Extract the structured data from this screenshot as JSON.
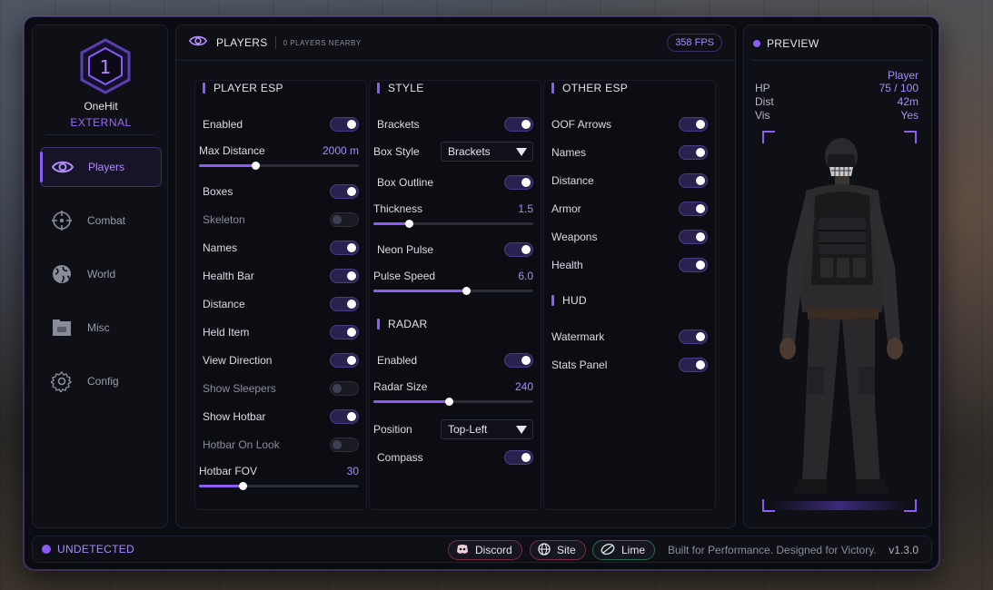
{
  "brand": {
    "logo_number": "1",
    "name": "OneHit",
    "sub": "EXTERNAL"
  },
  "nav": [
    {
      "label": "Players",
      "icon": "eye-icon",
      "active": true
    },
    {
      "label": "Combat",
      "icon": "crosshair-icon"
    },
    {
      "label": "World",
      "icon": "globe-icon"
    },
    {
      "label": "Misc",
      "icon": "box-icon"
    },
    {
      "label": "Config",
      "icon": "gear-icon"
    }
  ],
  "header": {
    "title": "PLAYERS",
    "subtitle": "0 PLAYERS NEARBY",
    "fps": "358 FPS"
  },
  "player_esp": {
    "title": "PLAYER ESP",
    "enabled": "Enabled",
    "max_distance": {
      "label": "Max Distance",
      "value": "2000 m",
      "fraction": 0.35
    },
    "toggles": [
      {
        "label": "Boxes",
        "on": true
      },
      {
        "label": "Skeleton",
        "on": false
      },
      {
        "label": "Names",
        "on": true
      },
      {
        "label": "Health Bar",
        "on": true
      },
      {
        "label": "Distance",
        "on": true
      },
      {
        "label": "Held Item",
        "on": true
      },
      {
        "label": "View Direction",
        "on": true
      },
      {
        "label": "Show Sleepers",
        "on": false
      },
      {
        "label": "Show Hotbar",
        "on": true
      },
      {
        "label": "Hotbar On Look",
        "on": false
      }
    ],
    "hotbar_fov": {
      "label": "Hotbar FOV",
      "value": "30",
      "fraction": 0.27
    }
  },
  "style": {
    "title": "STYLE",
    "brackets": "Brackets",
    "box_style": {
      "label": "Box Style",
      "selected": "Brackets"
    },
    "box_outline": "Box Outline",
    "thickness": {
      "label": "Thickness",
      "value": "1.5",
      "fraction": 0.22
    },
    "neon_pulse": "Neon Pulse",
    "pulse_speed": {
      "label": "Pulse Speed",
      "value": "6.0",
      "fraction": 0.58
    }
  },
  "radar": {
    "title": "RADAR",
    "enabled": "Enabled",
    "radar_size": {
      "label": "Radar Size",
      "value": "240",
      "fraction": 0.47
    },
    "position": {
      "label": "Position",
      "selected": "Top-Left"
    },
    "compass": "Compass"
  },
  "other_esp": {
    "title": "OTHER ESP",
    "toggles": [
      {
        "label": "OOF Arrows",
        "on": true
      },
      {
        "label": "Names",
        "on": true
      },
      {
        "label": "Distance",
        "on": true
      },
      {
        "label": "Armor",
        "on": true
      },
      {
        "label": "Weapons",
        "on": true
      },
      {
        "label": "Health",
        "on": true
      }
    ]
  },
  "hud": {
    "title": "HUD",
    "toggles": [
      {
        "label": "Watermark",
        "on": true
      },
      {
        "label": "Stats Panel",
        "on": true
      }
    ]
  },
  "preview": {
    "title": "PREVIEW",
    "player_label": "Player",
    "stats": [
      {
        "key": "HP",
        "value": "75 / 100"
      },
      {
        "key": "Dist",
        "value": "42m"
      },
      {
        "key": "Vis",
        "value": "Yes"
      }
    ]
  },
  "footer": {
    "status": "UNDETECTED",
    "discord": "Discord",
    "site": "Site",
    "lime": "Lime",
    "tagline": "Built for Performance. Designed for Victory.",
    "version": "v1.3.0"
  },
  "colors": {
    "accent": "#8b5cf6",
    "accent_text": "#a88bff",
    "panel": "#0e1016",
    "window": "#0b0c12"
  }
}
